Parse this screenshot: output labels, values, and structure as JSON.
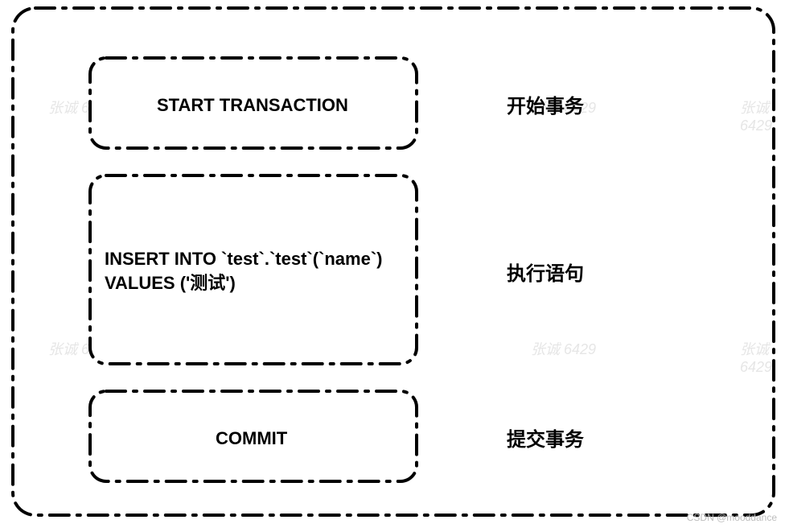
{
  "steps": [
    {
      "code": "START TRANSACTION",
      "label": "开始事务"
    },
    {
      "code": "INSERT INTO `test`.`test`(`name`)\nVALUES ('测试')",
      "label": "执行语句"
    },
    {
      "code": "COMMIT",
      "label": "提交事务"
    }
  ],
  "watermark": "张诚 6429",
  "attribution": "CSDN @mooddance"
}
